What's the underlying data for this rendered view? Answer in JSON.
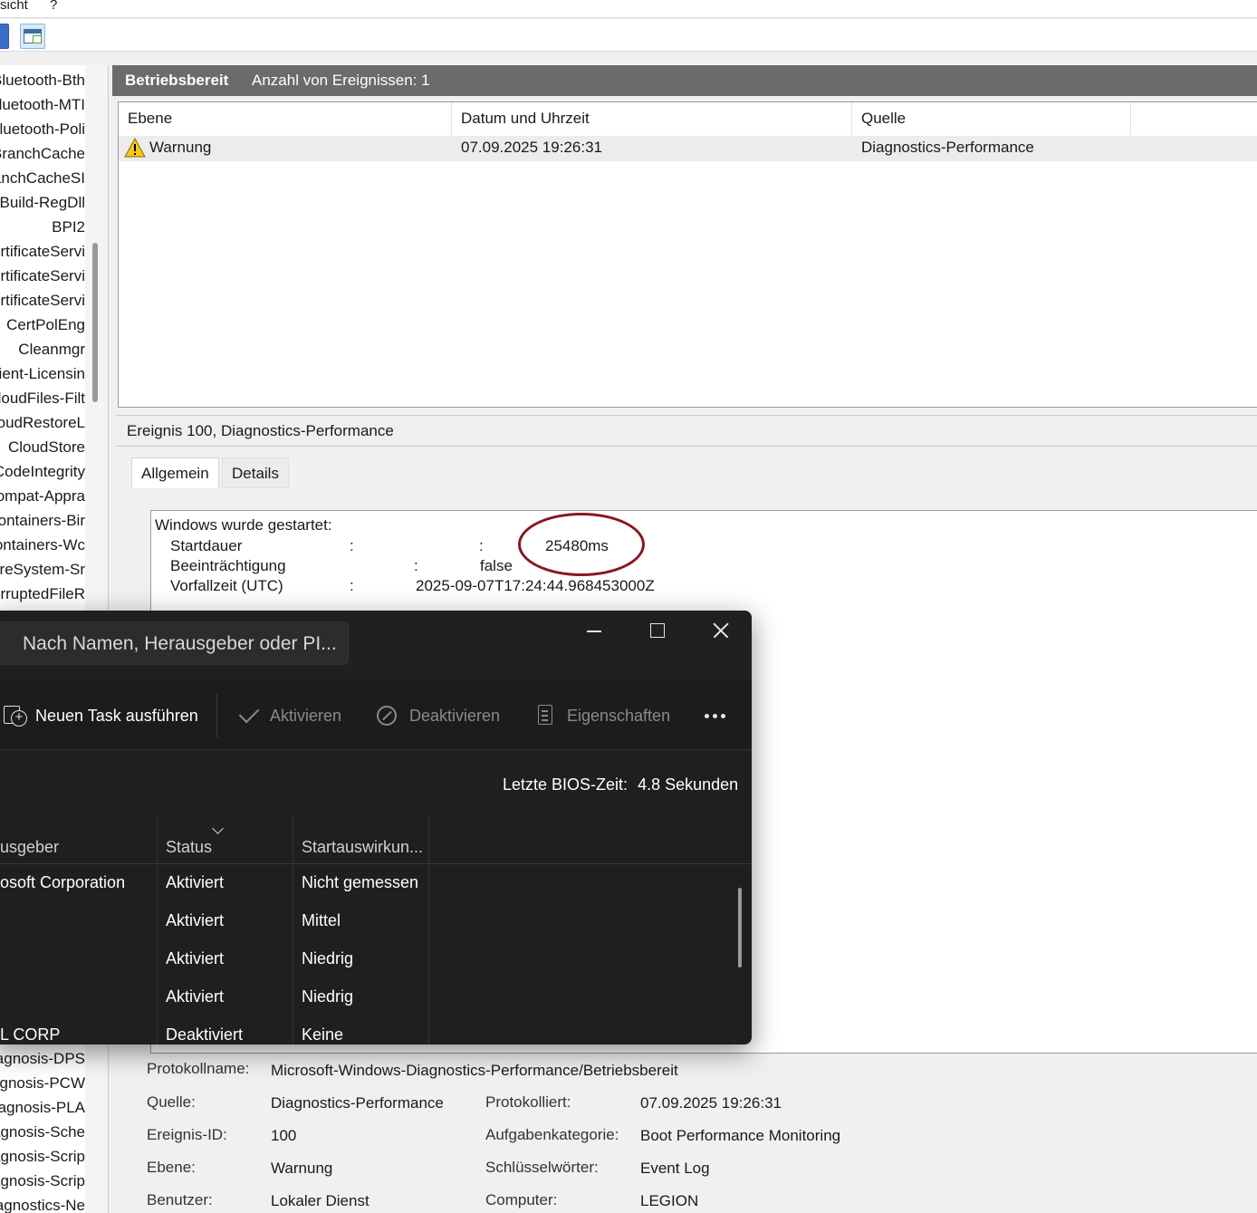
{
  "menubar": {
    "items": [
      "sicht",
      "?"
    ]
  },
  "tree": {
    "items": [
      "Bluetooth-Bth",
      "Bluetooth-MTI",
      "Bluetooth-Poli",
      "BranchCache",
      "BranchCacheSI",
      "Build-RegDll",
      "BPI2",
      "CertificateServi",
      "CertificateServi",
      "CertificateServi",
      "CertPolEng",
      "Cleanmgr",
      "Client-Licensin",
      "CloudFiles-Filt",
      "CloudRestoreL",
      "CloudStore",
      "CodeIntegrity",
      "Compat-Appra",
      "Containers-Bir",
      "Containers-Wc",
      "CoreSystem-Sr",
      "CorruptedFileR",
      "Diagnosis-DPS",
      "Diagnosis-PCW",
      "Diagnosis-PLA",
      "Diagnosis-Sche",
      "Diagnosis-Scrip",
      "Diagnosis-Scrip",
      "Diagnostics-Ne"
    ]
  },
  "event_viewer": {
    "header_title": "Betriebsbereit",
    "header_count": "Anzahl von Ereignissen: 1",
    "columns": [
      "Ebene",
      "Datum und Uhrzeit",
      "Quelle"
    ],
    "rows": [
      {
        "level": "Warnung",
        "datetime": "07.09.2025 19:26:31",
        "source": "Diagnostics-Performance"
      }
    ],
    "detail_title": "Ereignis 100, Diagnostics-Performance",
    "tabs": [
      "Allgemein",
      "Details"
    ],
    "description": {
      "line1": "Windows wurde gestartet:",
      "startdauer_label": "Startdauer",
      "colon": ":",
      "startdauer_value": "25480ms",
      "beeintraechtigung_label": "Beeinträchtigung",
      "beeintraechtigung_value": "false",
      "vorfallzeit_label": "Vorfallzeit (UTC)",
      "vorfallzeit_value": "2025-09-07T17:24:44.968453000Z"
    },
    "meta": {
      "protokollname_label": "Protokollname:",
      "protokollname_value": "Microsoft-Windows-Diagnostics-Performance/Betriebsbereit",
      "quelle_label": "Quelle:",
      "quelle_value": "Diagnostics-Performance",
      "protokolliert_label": "Protokolliert:",
      "protokolliert_value": "07.09.2025 19:26:31",
      "ereignis_id_label": "Ereignis-ID:",
      "ereignis_id_value": "100",
      "aufgabenkategorie_label": "Aufgabenkategorie:",
      "aufgabenkategorie_value": "Boot Performance Monitoring",
      "ebene_label": "Ebene:",
      "ebene_value": "Warnung",
      "schluesselwoerter_label": "Schlüsselwörter:",
      "schluesselwoerter_value": "Event Log",
      "benutzer_label": "Benutzer:",
      "benutzer_value": "Lokaler Dienst",
      "computer_label": "Computer:",
      "computer_value": "LEGION"
    }
  },
  "task_manager": {
    "search_placeholder": "Nach Namen, Herausgeber oder PI...",
    "commands": {
      "new_task": "Neuen Task ausführen",
      "activate": "Aktivieren",
      "deactivate": "Deaktivieren",
      "properties": "Eigenschaften"
    },
    "bios_label": "Letzte BIOS-Zeit:",
    "bios_value": "4.8 Sekunden",
    "columns": {
      "publisher": "usgeber",
      "status": "Status",
      "impact": "Startauswirkun..."
    },
    "rows": [
      {
        "publisher": "osoft Corporation",
        "status": "Aktiviert",
        "impact": "Nicht gemessen"
      },
      {
        "publisher": "",
        "status": "Aktiviert",
        "impact": "Mittel"
      },
      {
        "publisher": "",
        "status": "Aktiviert",
        "impact": "Niedrig"
      },
      {
        "publisher": "",
        "status": "Aktiviert",
        "impact": "Niedrig"
      },
      {
        "publisher": "L CORP",
        "status": "Deaktiviert",
        "impact": "Keine"
      }
    ]
  },
  "colors": {
    "header_bar": "#6b6b6b",
    "annotation_ellipse": "#8a1522",
    "taskman_bg": "#1f1f1f",
    "warning_yellow": "#f2c81e"
  }
}
